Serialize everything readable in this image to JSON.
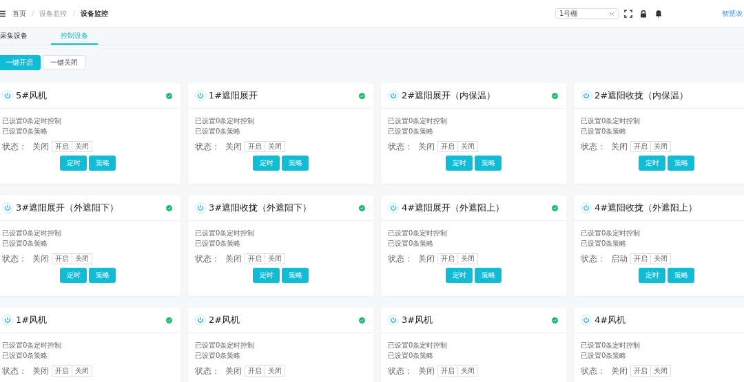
{
  "breadcrumb": [
    "首页",
    "设备监控",
    "设备监控"
  ],
  "breadcrumb_separator": "/",
  "greenhouse_select": {
    "value": "1号棚"
  },
  "brand": "智慧农",
  "tabs": [
    {
      "label": "采集设备",
      "selected": false
    },
    {
      "label": "控制设备",
      "selected": true
    }
  ],
  "actions": [
    {
      "label": "一键开启",
      "kind": "primary"
    },
    {
      "label": "一键关闭",
      "kind": "plain"
    }
  ],
  "devices": [
    {
      "name": "5#风机",
      "online": true,
      "timers": "已设置0条定时控制",
      "strategies": "已设置0条策略",
      "state_label": "状态：",
      "state": "关闭",
      "on": "开启",
      "off": "关闭",
      "timer_button": "定时",
      "strategy_button": "策略"
    },
    {
      "name": "1#遮阳展开",
      "online": true,
      "timers": "已设置0条定时控制",
      "strategies": "已设置0条策略",
      "state_label": "状态：",
      "state": "关闭",
      "on": "开启",
      "off": "关闭",
      "timer_button": "定时",
      "strategy_button": "策略"
    },
    {
      "name": "2#遮阳展开（内保温）",
      "online": true,
      "timers": "已设置0条定时控制",
      "strategies": "已设置0条策略",
      "state_label": "状态：",
      "state": "关闭",
      "on": "开启",
      "off": "关闭",
      "timer_button": "定时",
      "strategy_button": "策略"
    },
    {
      "name": "2#遮阳收拢（内保温）",
      "timers": "已设置0条定时控制",
      "strategies": "已设置0条策略",
      "state_label": "状态：",
      "state": "关闭",
      "on": "开启",
      "off": "关闭",
      "timer_button": "定时",
      "strategy_button": "策略"
    },
    {
      "name": "3#遮阳展开（外遮阳下）",
      "online": true,
      "timers": "已设置0条定时控制",
      "strategies": "已设置0条策略",
      "state_label": "状态：",
      "state": "关闭",
      "on": "开启",
      "off": "关闭",
      "timer_button": "定时",
      "strategy_button": "策略"
    },
    {
      "name": "3#遮阳收拢（外遮阳下）",
      "online": true,
      "timers": "已设置0条定时控制",
      "strategies": "已设置0条策略",
      "state_label": "状态：",
      "state": "关闭",
      "on": "开启",
      "off": "关闭",
      "timer_button": "定时",
      "strategy_button": "策略"
    },
    {
      "name": "4#遮阳展开（外遮阳上）",
      "online": true,
      "timers": "已设置0条定时控制",
      "strategies": "已设置0条策略",
      "state_label": "状态：",
      "state": "关闭",
      "on": "开启",
      "off": "关闭",
      "timer_button": "定时",
      "strategy_button": "策略"
    },
    {
      "name": "4#遮阳收拢（外遮阳上）",
      "timers": "已设置0条定时控制",
      "strategies": "已设置0条策略",
      "state_label": "状态：",
      "state": "启动",
      "on": "开启",
      "off": "关闭",
      "timer_button": "定时",
      "strategy_button": "策略"
    },
    {
      "name": "1#风机",
      "online": true,
      "timers": "已设置0条定时控制",
      "strategies": "已设置0条策略",
      "state_label": "状态：",
      "state": "关闭",
      "on": "开启",
      "off": "关闭"
    },
    {
      "name": "2#风机",
      "online": true,
      "timers": "已设置0条定时控制",
      "strategies": "已设置0条策略",
      "state_label": "状态：",
      "state": "关闭",
      "on": "开启",
      "off": "关闭"
    },
    {
      "name": "3#风机",
      "online": true,
      "timers": "已设置0条定时控制",
      "strategies": "已设置0条策略",
      "state_label": "状态：",
      "state": "关闭",
      "on": "开启",
      "off": "关闭"
    },
    {
      "name": "4#风机",
      "timers": "已设置0条定时控制",
      "strategies": "已设置0条策略",
      "state_label": "状态：",
      "state": "关闭",
      "on": "开启",
      "off": "关闭"
    }
  ]
}
